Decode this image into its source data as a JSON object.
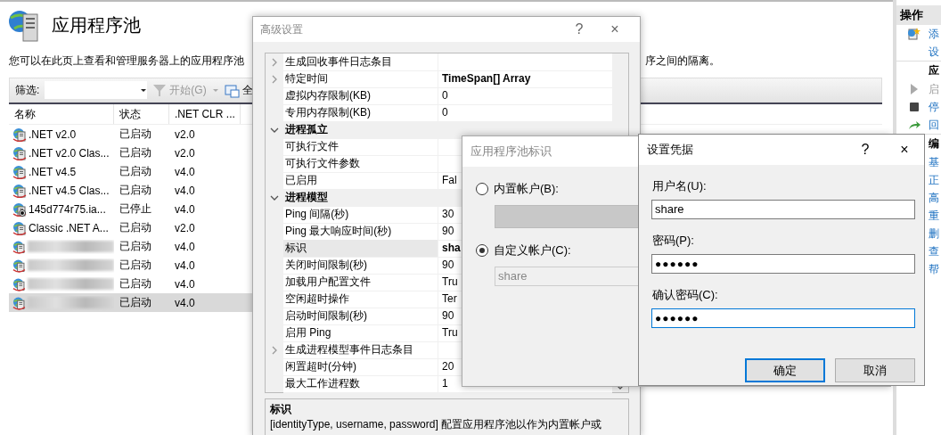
{
  "page": {
    "title": "应用程序池",
    "description": "您可以在此页上查看和管理服务器上的应用程序池",
    "description_tail": "序之间的隔离。"
  },
  "toolbar": {
    "filter_label": "筛选:",
    "start_button": "开始(G)",
    "show_all": "全"
  },
  "table": {
    "columns": [
      "名称",
      "状态",
      ".NET CLR ..."
    ],
    "rows": [
      {
        "kind": "named",
        "name": ".NET v2.0",
        "status": "已启动",
        "running": true,
        "clr": "v2.0",
        "selected": false
      },
      {
        "kind": "named",
        "name": ".NET v2.0 Clas...",
        "status": "已启动",
        "running": true,
        "clr": "v2.0",
        "selected": false
      },
      {
        "kind": "named",
        "name": ".NET v4.5",
        "status": "已启动",
        "running": true,
        "clr": "v4.0",
        "selected": false
      },
      {
        "kind": "named",
        "name": ".NET v4.5 Clas...",
        "status": "已启动",
        "running": true,
        "clr": "v4.0",
        "selected": false
      },
      {
        "kind": "named",
        "name": "145d774r75.ia...",
        "status": "已停止",
        "running": false,
        "clr": "v4.0",
        "selected": false
      },
      {
        "kind": "named",
        "name": "Classic .NET A...",
        "status": "已启动",
        "running": true,
        "clr": "v2.0",
        "selected": false
      },
      {
        "kind": "redacted",
        "status": "已启动",
        "running": true,
        "clr": "v4.0",
        "selected": false
      },
      {
        "kind": "redacted",
        "status": "已启动",
        "running": true,
        "clr": "v4.0",
        "selected": false
      },
      {
        "kind": "redacted",
        "status": "已启动",
        "running": true,
        "clr": "v4.0",
        "selected": false
      },
      {
        "kind": "redacted",
        "status": "已启动",
        "running": true,
        "clr": "v4.0",
        "selected": true
      }
    ]
  },
  "actions": {
    "title": "操作",
    "items": [
      {
        "kind": "add",
        "label": "添",
        "disabled": false
      },
      {
        "kind": "link",
        "label": "设",
        "disabled": false
      },
      {
        "kind": "header",
        "label": "应"
      },
      {
        "kind": "start",
        "label": "启",
        "disabled": true
      },
      {
        "kind": "stop",
        "label": "停",
        "disabled": false
      },
      {
        "kind": "recycle",
        "label": "回",
        "disabled": false
      },
      {
        "kind": "header",
        "label": "编"
      },
      {
        "kind": "link",
        "label": "基",
        "disabled": false
      },
      {
        "kind": "link",
        "label": "正",
        "disabled": false
      },
      {
        "kind": "link",
        "label": "高",
        "disabled": false
      },
      {
        "kind": "link",
        "label": "重",
        "disabled": false
      },
      {
        "kind": "link",
        "label": "删",
        "disabled": false
      },
      {
        "kind": "link",
        "label": "查",
        "disabled": false
      },
      {
        "kind": "link",
        "label": "帮",
        "disabled": false
      }
    ]
  },
  "advanced": {
    "title": "高级设置",
    "help": "?",
    "close": "×",
    "rows": [
      {
        "kind": "property",
        "name": "生成回收事件日志条目",
        "expanded": false,
        "selected": false
      },
      {
        "kind": "property",
        "name": "特定时间",
        "value": "TimeSpan[] Array",
        "modified": true,
        "expanded": false,
        "selected": false
      },
      {
        "kind": "property",
        "name": "虚拟内存限制(KB)",
        "value": "0",
        "modified": false,
        "selected": false
      },
      {
        "kind": "property",
        "name": "专用内存限制(KB)",
        "value": "0",
        "modified": false,
        "selected": false
      },
      {
        "kind": "category",
        "name": "进程孤立",
        "expanded": true
      },
      {
        "kind": "property",
        "name": "可执行文件",
        "selected": false
      },
      {
        "kind": "property",
        "name": "可执行文件参数",
        "selected": false
      },
      {
        "kind": "property",
        "name": "已启用",
        "value": "Fal",
        "modified": false,
        "selected": false
      },
      {
        "kind": "category",
        "name": "进程模型",
        "expanded": true
      },
      {
        "kind": "property",
        "name": "Ping 间隔(秒)",
        "value": "30",
        "modified": false,
        "selected": false
      },
      {
        "kind": "property",
        "name": "Ping 最大响应时间(秒)",
        "value": "90",
        "modified": false,
        "selected": false
      },
      {
        "kind": "property",
        "name": "标识",
        "value": "sha",
        "modified": true,
        "selected": true
      },
      {
        "kind": "property",
        "name": "关闭时间限制(秒)",
        "value": "90",
        "modified": false,
        "selected": false
      },
      {
        "kind": "property",
        "name": "加载用户配置文件",
        "value": "Tru",
        "modified": false,
        "selected": false
      },
      {
        "kind": "property",
        "name": "空闲超时操作",
        "value": "Ter",
        "modified": false,
        "selected": false
      },
      {
        "kind": "property",
        "name": "启动时间限制(秒)",
        "value": "90",
        "modified": false,
        "selected": false
      },
      {
        "kind": "property",
        "name": "启用 Ping",
        "value": "Tru",
        "modified": false,
        "selected": false
      },
      {
        "kind": "property",
        "name": "生成进程模型事件日志条目",
        "expanded": false,
        "selected": false
      },
      {
        "kind": "property",
        "name": "闲置超时(分钟)",
        "value": "20",
        "modified": false,
        "selected": false
      },
      {
        "kind": "property",
        "name": "最大工作进程数",
        "value": "1",
        "modified": false,
        "selected": false
      }
    ],
    "description_title": "标识",
    "description": "[identityType, username, password] 配置应用程序池以作为内置帐户或"
  },
  "identity_dialog": {
    "title": "应用程序池标识",
    "options": [
      {
        "kind": "dropdown",
        "label": "内置帐户(B):",
        "selected": false
      },
      {
        "kind": "textbox",
        "label": "自定义帐户(C):",
        "value": "share",
        "selected": true
      }
    ]
  },
  "credentials": {
    "title": "设置凭据",
    "help": "?",
    "close": "×",
    "fields": [
      {
        "kind": "text",
        "label": "用户名(U):",
        "value": "share",
        "focused": false
      },
      {
        "kind": "password",
        "label": "密码(P):",
        "value": "●●●●●●",
        "focused": false
      },
      {
        "kind": "password",
        "label": "确认密码(C):",
        "value": "●●●●●●",
        "focused": true
      }
    ],
    "buttons": [
      {
        "label": "确定",
        "default": true
      },
      {
        "label": "取消",
        "default": false
      }
    ]
  }
}
